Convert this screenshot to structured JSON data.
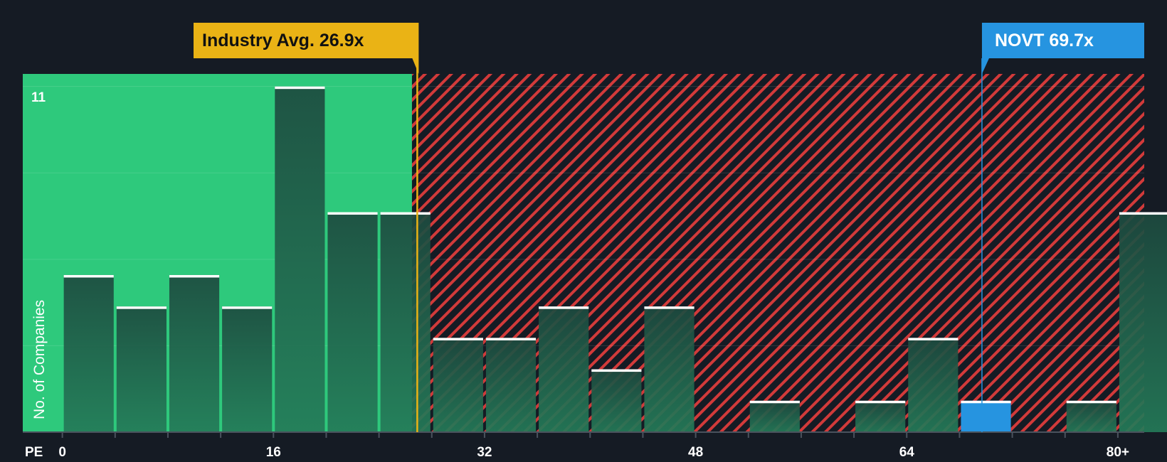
{
  "chart_data": {
    "type": "bar",
    "x_axis_label": "PE",
    "ylabel": "No. of Companies",
    "y_max_label": "11",
    "ylim": [
      0,
      11.4
    ],
    "x_ticks": [
      "0",
      "16",
      "32",
      "48",
      "64",
      "80+"
    ],
    "x_tick_values": [
      0,
      16,
      32,
      48,
      64,
      80
    ],
    "xlim": [
      -3,
      82
    ],
    "bin_width": 4,
    "bins_start": [
      0,
      4,
      8,
      12,
      16,
      20,
      24,
      28,
      32,
      36,
      40,
      44,
      48,
      52,
      56,
      60,
      64,
      68,
      72,
      76,
      80
    ],
    "values": [
      5,
      4,
      5,
      4,
      11,
      7,
      7,
      3,
      3,
      4,
      2,
      4,
      0,
      1,
      0,
      1,
      3,
      1,
      0,
      1,
      7
    ],
    "fair_range_max": 26.5,
    "industry_avg": {
      "label": "Industry Avg. 26.9x",
      "value": 26.9
    },
    "company": {
      "label": "NOVT 69.7x",
      "value": 69.7,
      "bin_index": 17
    },
    "colors": {
      "background": "#151b24",
      "fair_zone": "#2ec97c",
      "bar_fill": "#1e4a3e",
      "bar_cap": "#ffffff",
      "hatch": "#d23a3a",
      "industry": "#eab315",
      "company": "#2694e0"
    }
  }
}
